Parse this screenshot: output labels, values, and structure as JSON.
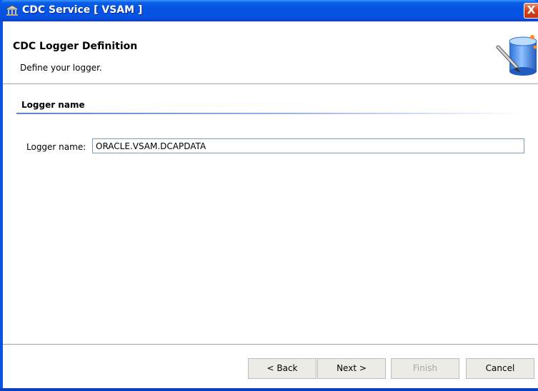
{
  "window": {
    "title": "CDC Service [ VSAM ]",
    "close_label": "X",
    "icon": "bank-building-icon"
  },
  "header": {
    "title": "CDC Logger Definition",
    "description": "Define your logger.",
    "image": "database-edit-icon"
  },
  "section": {
    "title": "Logger name"
  },
  "form": {
    "logger_name_label": "Logger name:",
    "logger_name_value": "ORACLE.VSAM.DCAPDATA"
  },
  "buttons": {
    "back": "< Back",
    "next": "Next >",
    "finish": "Finish",
    "cancel": "Cancel"
  },
  "colors": {
    "titlebar": "#0553e0",
    "accent": "#5f7fd4"
  }
}
